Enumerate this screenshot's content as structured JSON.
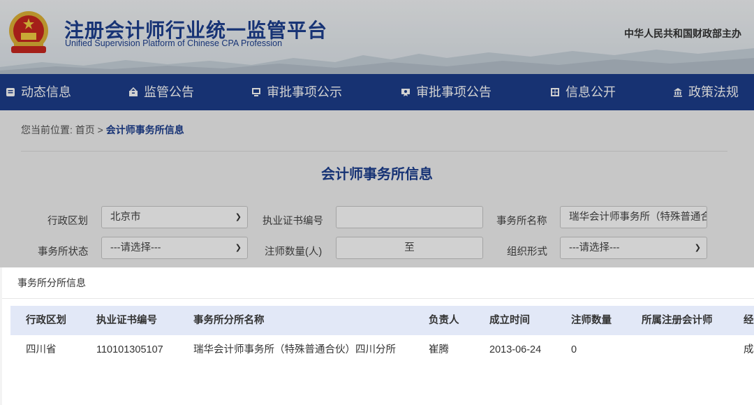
{
  "header": {
    "title": "注册会计师行业统一监管平台",
    "subtitle": "Unified Supervision Platform of Chinese CPA Profession",
    "sponsor": "中华人民共和国财政部主办"
  },
  "nav": {
    "items": [
      {
        "label": "动态信息",
        "icon": "news-icon"
      },
      {
        "label": "监管公告",
        "icon": "notice-icon"
      },
      {
        "label": "审批事项公示",
        "icon": "monitor-icon"
      },
      {
        "label": "审批事项公告",
        "icon": "certificate-icon"
      },
      {
        "label": "信息公开",
        "icon": "info-icon"
      },
      {
        "label": "政策法规",
        "icon": "institution-icon"
      }
    ]
  },
  "breadcrumb": {
    "prefix": "您当前位置: 首页 > ",
    "current": "会计师事务所信息"
  },
  "page": {
    "title": "会计师事务所信息"
  },
  "filters": {
    "region_label": "行政区划",
    "region_value": "北京市",
    "cert_label": "执业证书编号",
    "cert_value": "",
    "name_label": "事务所名称",
    "name_value": "瑞华会计师事务所（特殊普通合伙）",
    "status_label": "事务所状态",
    "status_value": "---请选择---",
    "cpa_count_label": "注师数量(人)",
    "cpa_count_sep": "至",
    "org_form_label": "组织形式",
    "org_form_value": "---请选择---"
  },
  "modal": {
    "title": "事务所分所信息",
    "columns": [
      "行政区划",
      "执业证书编号",
      "事务所分所名称",
      "负责人",
      "成立时间",
      "注师数量",
      "所属注册会计师",
      "经营场所"
    ],
    "rows": [
      [
        "四川省",
        "110101305107",
        "瑞华会计师事务所（特殊普通合伙）四川分所",
        "崔腾",
        "2013-06-24",
        "0",
        "",
        "成都市"
      ]
    ]
  },
  "colors": {
    "brand_blue": "#1d3e8c",
    "table_header_bg": "#e2e8f7"
  }
}
